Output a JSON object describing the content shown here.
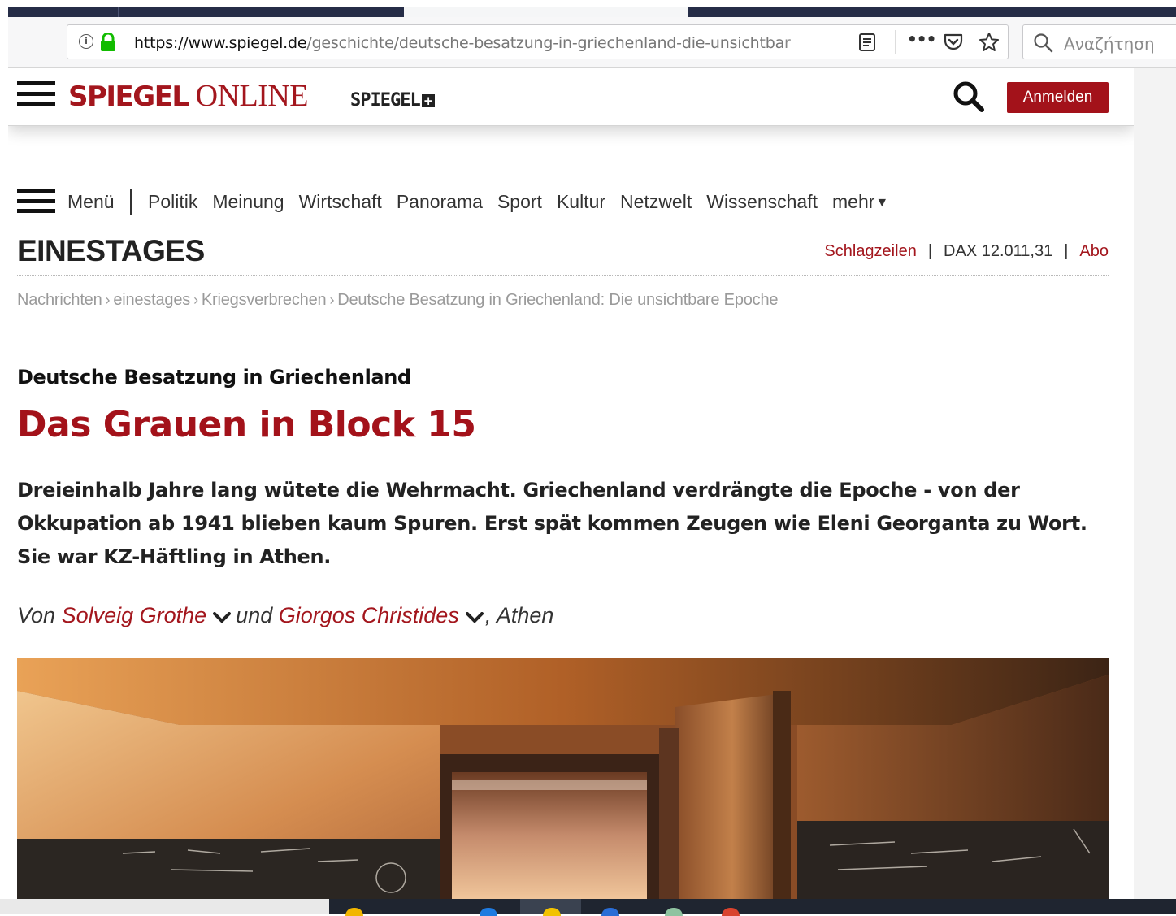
{
  "browser": {
    "url_host": "https://www.spiegel.de",
    "url_path": "/geschichte/deutsche-besatzung-in-griechenland-die-unsichtbar",
    "search_placeholder": "Αναζήτηση"
  },
  "header": {
    "logo_part1": "SPIEGEL",
    "logo_part2": "ONLINE",
    "plus_logo": "SPIEGEL",
    "plus_glyph": "+",
    "login_label": "Anmelden"
  },
  "nav": {
    "menu_label": "Menü",
    "items": [
      "Politik",
      "Meinung",
      "Wirtschaft",
      "Panorama",
      "Sport",
      "Kultur",
      "Netzwelt",
      "Wissenschaft",
      "mehr"
    ],
    "more_arrow": "▼"
  },
  "section": {
    "title": "EINESTAGES",
    "headlines_link": "Schlagzeilen",
    "dax": "DAX 12.011,31",
    "abo_link": "Abo"
  },
  "breadcrumb": [
    "Nachrichten",
    "einestages",
    "Kriegsverbrechen",
    "Deutsche Besatzung in Griechenland: Die unsichtbare Epoche"
  ],
  "article": {
    "kicker": "Deutsche Besatzung in Griechenland",
    "headline": "Das Grauen in Block 15",
    "teaser": "Dreieinhalb Jahre lang wütete die Wehrmacht. Griechenland verdrängte die Epoche - von der Okkupation ab 1941 blieben kaum Spuren. Erst spät kommen Zeugen wie Eleni Georganta zu Wort. Sie war KZ-Häftling in Athen.",
    "byline_von": "Von",
    "author1": "Solveig Grothe",
    "byline_und": "und",
    "author2": "Giorgos Christides",
    "byline_place": ", Athen"
  },
  "colors": {
    "brand_red": "#a3161d",
    "tabstrip": "#262d47",
    "taskbar": "#1f2530"
  },
  "icons": [
    "info-icon",
    "lock-icon",
    "reader-view-icon",
    "more-actions-icon",
    "pocket-icon",
    "bookmark-star-icon",
    "search-icon",
    "hamburger-menu-icon",
    "chevron-down-icon"
  ]
}
